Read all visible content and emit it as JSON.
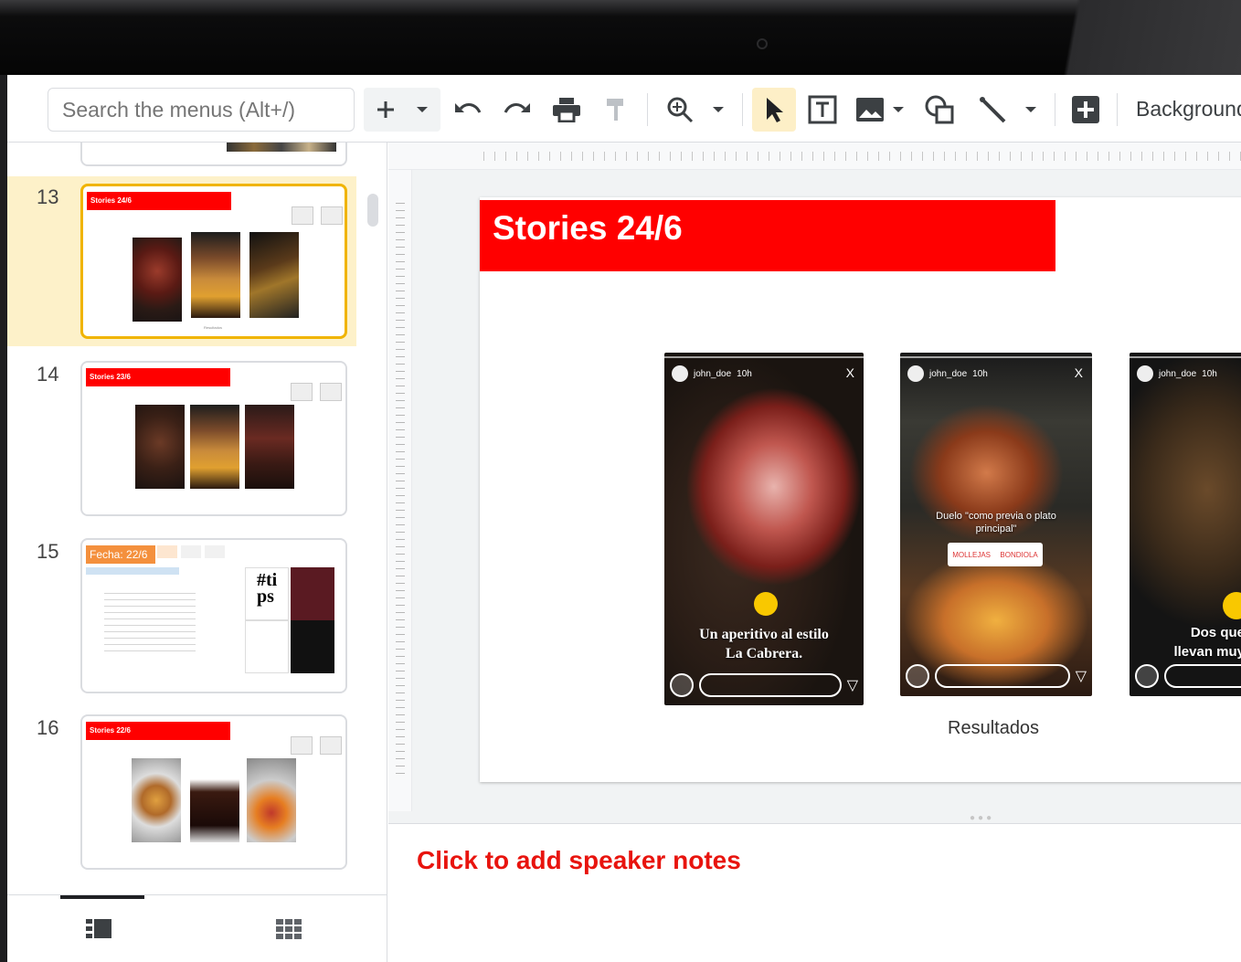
{
  "toolbar": {
    "search_placeholder": "Search the menus (Alt+/)",
    "background_label": "Background",
    "icons": [
      "plus-icon",
      "dropdown-icon",
      "undo-icon",
      "redo-icon",
      "print-icon",
      "paint-format-icon",
      "zoom-icon",
      "dropdown-icon",
      "select-icon",
      "textbox-icon",
      "image-icon",
      "shape-icon",
      "line-icon",
      "new-slide-icon"
    ]
  },
  "filmstrip": {
    "slides": [
      {
        "num": "13",
        "title": "Stories 24/6",
        "footer": "Resultados",
        "selected": true
      },
      {
        "num": "14",
        "title": "Stories 23/6",
        "selected": false
      },
      {
        "num": "15",
        "title": "Fecha: 22/6",
        "selected": false
      },
      {
        "num": "16",
        "title": "Stories 22/6",
        "selected": false
      }
    ]
  },
  "slide": {
    "title": "Stories 24/6",
    "results_label": "Resultados",
    "stories": [
      {
        "user": "john_doe",
        "time": "10h",
        "caption": "Un aperitivo al estilo La Cabrera."
      },
      {
        "user": "john_doe",
        "time": "10h",
        "caption": "Duelo \"como previa o plato principal\"",
        "chip1": "MOLLEJAS",
        "chip2": "BONDIOLA"
      },
      {
        "user": "john_doe",
        "time": "10h",
        "caption": "Dos que llevan muy"
      }
    ]
  },
  "notes": {
    "placeholder": "Click to add speaker notes"
  },
  "colors": {
    "accent_red": "#ff0000",
    "selection_yellow": "#fdf1c9",
    "selection_border": "#f0b400",
    "notes_red": "#e8140e"
  }
}
